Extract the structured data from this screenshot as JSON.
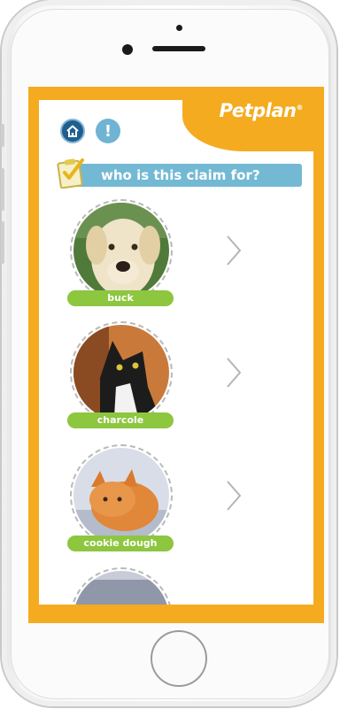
{
  "app": {
    "logo_text": "Petplan",
    "logo_mark": "®"
  },
  "header": {
    "home_icon": "home-icon",
    "info_icon_label": "!",
    "banner_text": "who is this claim for?"
  },
  "pets": [
    {
      "name": "buck",
      "photo": "dog-photo"
    },
    {
      "name": "charcole",
      "photo": "cat-photo"
    },
    {
      "name": "cookie dough",
      "photo": "cat-photo"
    }
  ],
  "colors": {
    "brand_orange": "#f5ab1f",
    "banner_blue": "#73b9d3",
    "label_green": "#8dc63f",
    "home_blue": "#1f5f8f"
  }
}
